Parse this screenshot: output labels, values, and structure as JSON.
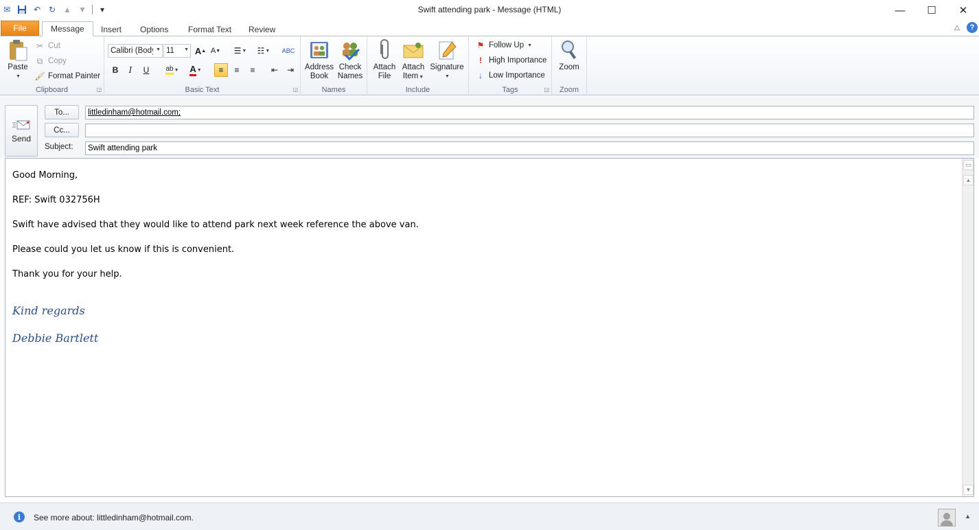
{
  "window": {
    "title": "Swift attending park  -  Message (HTML)",
    "controls": {
      "minimize": "—",
      "maximize": "☐",
      "close": "✕"
    }
  },
  "quick_access": [
    {
      "icon": "outlook-icon",
      "glyph": "✉"
    },
    {
      "icon": "save-icon",
      "glyph": "💾"
    },
    {
      "icon": "undo-icon",
      "glyph": "↶"
    },
    {
      "icon": "redo-icon",
      "glyph": "↻"
    },
    {
      "icon": "up-icon",
      "glyph": "▲"
    },
    {
      "icon": "down-icon",
      "glyph": "▼"
    },
    {
      "icon": "customize-icon",
      "glyph": "▾"
    }
  ],
  "tabs": {
    "file": "File",
    "items": [
      "Message",
      "Insert",
      "Options",
      "Format Text",
      "Review"
    ],
    "active": "Message"
  },
  "ribbon": {
    "clipboard": {
      "label": "Clipboard",
      "paste": "Paste",
      "cut": "Cut",
      "copy": "Copy",
      "format_painter": "Format Painter"
    },
    "basic_text": {
      "label": "Basic Text",
      "font": "Calibri (Body)",
      "size": "11",
      "bold": "B",
      "italic": "I",
      "underline": "U"
    },
    "names": {
      "label": "Names",
      "address_book": [
        "Address",
        "Book"
      ],
      "check_names": [
        "Check",
        "Names"
      ]
    },
    "include": {
      "label": "Include",
      "attach_file": [
        "Attach",
        "File"
      ],
      "attach_item": [
        "Attach",
        "Item"
      ],
      "signature": "Signature"
    },
    "tags": {
      "label": "Tags",
      "follow_up": "Follow Up",
      "high": "High Importance",
      "low": "Low Importance"
    },
    "zoom": {
      "label": "Zoom",
      "zoom": "Zoom"
    }
  },
  "header": {
    "send": "Send",
    "to_button": "To...",
    "cc_button": "Cc...",
    "subject_label": "Subject:",
    "to_value": "littledinham@hotmail.com;",
    "cc_value": "",
    "subject_value": "Swift attending park"
  },
  "body": {
    "lines": [
      "Good Morning,",
      "REF: Swift 032756H",
      "Swift have advised that they would like to attend park next week reference the above van.",
      "Please could you let us know if this is convenient.",
      "Thank you for your help."
    ],
    "signature": [
      "Kind regards",
      "Debbie Bartlett"
    ]
  },
  "status": {
    "text": "See more about: littledinham@hotmail.com."
  },
  "colors": {
    "file_tab": "#e8861a",
    "signature": "#2b4e86",
    "accent": "#3b7bd1"
  }
}
